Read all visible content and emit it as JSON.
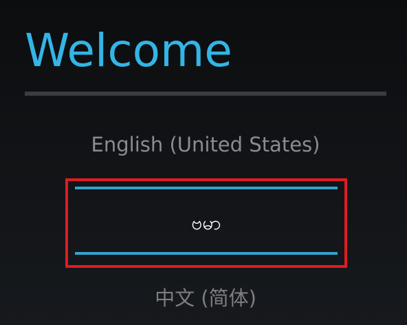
{
  "header": {
    "title": "Welcome"
  },
  "language_picker": {
    "options": [
      {
        "label": "English (United States)"
      },
      {
        "label": "ဗမာ",
        "selected": true
      },
      {
        "label": "中文 (简体)"
      }
    ]
  },
  "colors": {
    "accent": "#33b5e5",
    "divider": "#3a3c3f",
    "highlight_border": "#e01b24",
    "selection_line": "#33a3cf"
  }
}
